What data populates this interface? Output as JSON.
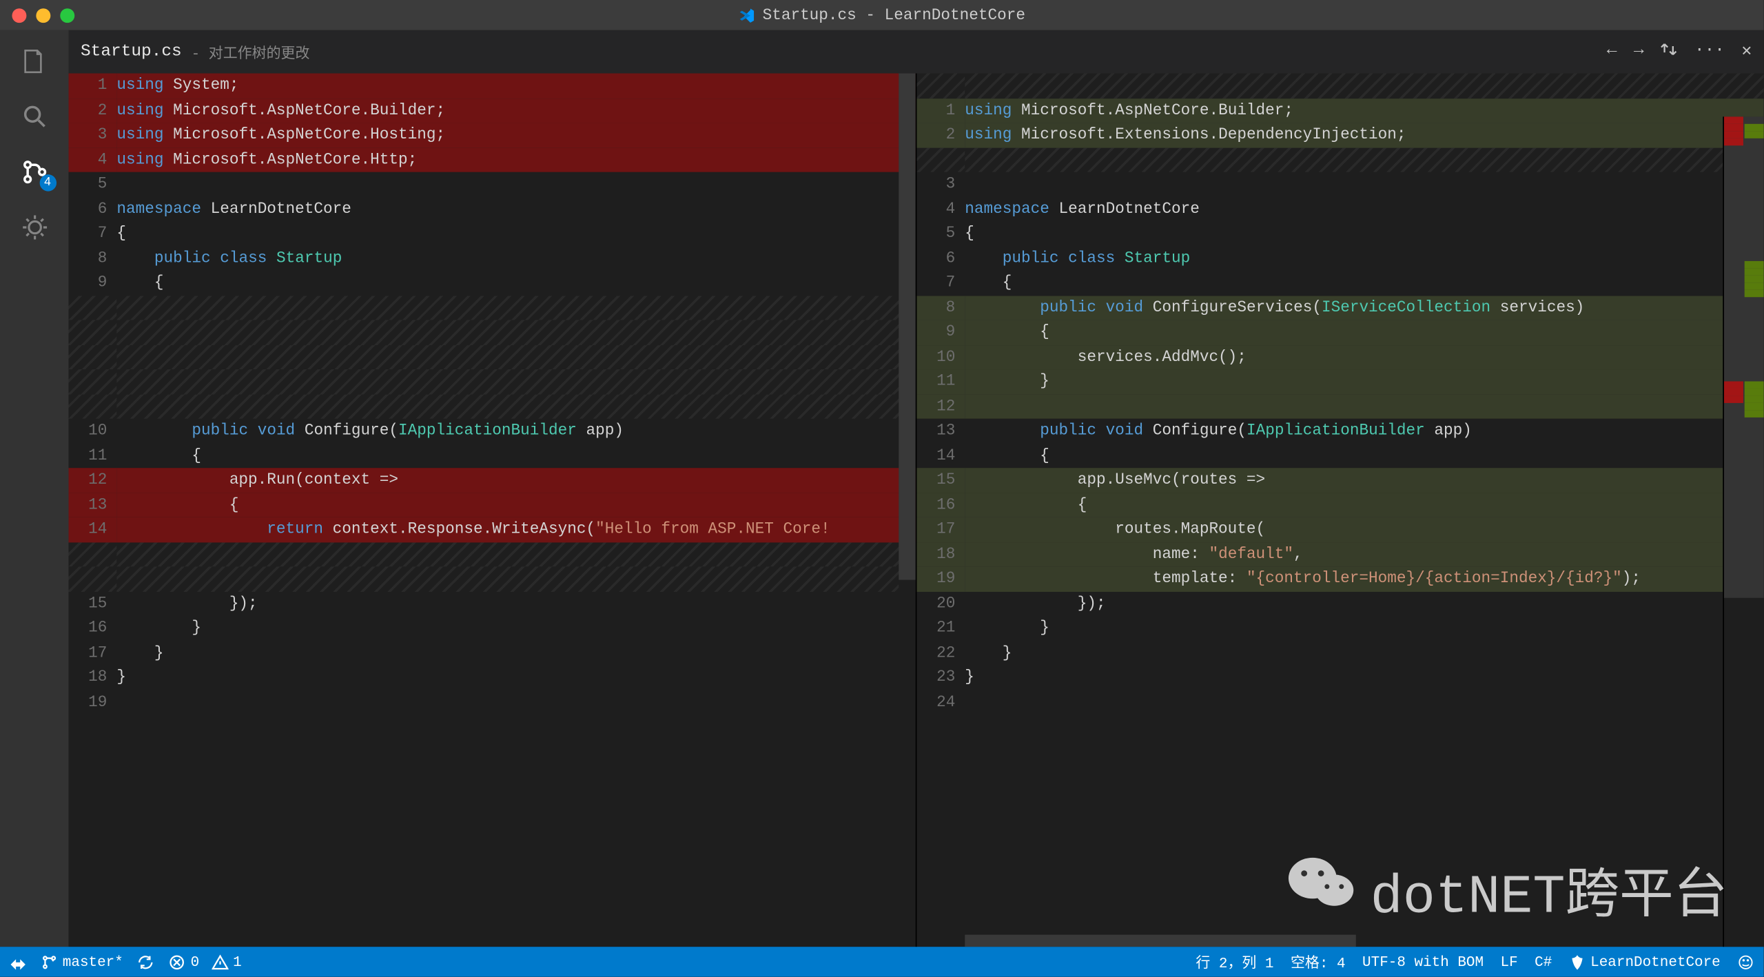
{
  "window": {
    "title": "Startup.cs - LearnDotnetCore"
  },
  "activitybar": {
    "scm_badge": "4"
  },
  "tab": {
    "filename": "Startup.cs",
    "description": "- 对工作树的更改"
  },
  "tabactions": {
    "prev": "←",
    "next": "→",
    "swap": "⇅",
    "more": "···",
    "close": "✕"
  },
  "left": {
    "lines": [
      {
        "n": "1",
        "cls": "del",
        "tokens": [
          [
            "kw",
            "using"
          ],
          [
            "ns",
            " System;"
          ]
        ]
      },
      {
        "n": "2",
        "cls": "del",
        "tokens": [
          [
            "kw",
            "using"
          ],
          [
            "ns",
            " Microsoft.AspNetCore.Builder;"
          ]
        ]
      },
      {
        "n": "3",
        "cls": "del",
        "tokens": [
          [
            "kw",
            "using"
          ],
          [
            "ns",
            " Microsoft.AspNetCore.Hosting;"
          ]
        ]
      },
      {
        "n": "4",
        "cls": "del",
        "tokens": [
          [
            "kw",
            "using"
          ],
          [
            "ns",
            " Microsoft.AspNetCore.Http;"
          ]
        ]
      },
      {
        "n": "5",
        "cls": "",
        "tokens": []
      },
      {
        "n": "6",
        "cls": "",
        "tokens": [
          [
            "kw",
            "namespace"
          ],
          [
            "ns",
            " LearnDotnetCore"
          ]
        ]
      },
      {
        "n": "7",
        "cls": "",
        "tokens": [
          [
            "ns",
            "{"
          ]
        ]
      },
      {
        "n": "8",
        "cls": "",
        "tokens": [
          [
            "ns",
            "    "
          ],
          [
            "kw",
            "public class"
          ],
          [
            "ns",
            " "
          ],
          [
            "tp",
            "Startup"
          ]
        ]
      },
      {
        "n": "9",
        "cls": "",
        "tokens": [
          [
            "ns",
            "    {"
          ]
        ]
      },
      {
        "n": "",
        "cls": "hatch",
        "tokens": []
      },
      {
        "n": "",
        "cls": "hatch",
        "tokens": []
      },
      {
        "n": "",
        "cls": "hatch",
        "tokens": []
      },
      {
        "n": "",
        "cls": "hatch",
        "tokens": []
      },
      {
        "n": "",
        "cls": "hatch",
        "tokens": []
      },
      {
        "n": "10",
        "cls": "",
        "tokens": [
          [
            "ns",
            "        "
          ],
          [
            "kw",
            "public void"
          ],
          [
            "ns",
            " Configure("
          ],
          [
            "tp",
            "IApplicationBuilder"
          ],
          [
            "ns",
            " app)"
          ]
        ]
      },
      {
        "n": "11",
        "cls": "",
        "tokens": [
          [
            "ns",
            "        {"
          ]
        ]
      },
      {
        "n": "12",
        "cls": "del",
        "tokens": [
          [
            "ns",
            "            app.Run(context =>"
          ]
        ]
      },
      {
        "n": "13",
        "cls": "del",
        "tokens": [
          [
            "ns",
            "            {"
          ]
        ]
      },
      {
        "n": "14",
        "cls": "del",
        "tokens": [
          [
            "ns",
            "                "
          ],
          [
            "kw",
            "return"
          ],
          [
            "ns",
            " context.Response.WriteAsync("
          ],
          [
            "st",
            "\"Hello from ASP.NET Core!"
          ]
        ]
      },
      {
        "n": "",
        "cls": "hatch",
        "tokens": []
      },
      {
        "n": "",
        "cls": "hatch",
        "tokens": []
      },
      {
        "n": "15",
        "cls": "",
        "tokens": [
          [
            "ns",
            "            });"
          ]
        ]
      },
      {
        "n": "16",
        "cls": "",
        "tokens": [
          [
            "ns",
            "        }"
          ]
        ]
      },
      {
        "n": "17",
        "cls": "",
        "tokens": [
          [
            "ns",
            "    }"
          ]
        ]
      },
      {
        "n": "18",
        "cls": "",
        "tokens": [
          [
            "ns",
            "}"
          ]
        ]
      },
      {
        "n": "19",
        "cls": "",
        "tokens": []
      }
    ]
  },
  "right": {
    "lines": [
      {
        "n": "",
        "cls": "hatch",
        "tokens": []
      },
      {
        "n": "1",
        "cls": "ins",
        "tokens": [
          [
            "kw",
            "using"
          ],
          [
            "ns",
            " Microsoft.AspNetCore.Builder;"
          ]
        ]
      },
      {
        "n": "2",
        "cls": "ins",
        "tokens": [
          [
            "kw",
            "using"
          ],
          [
            "ns",
            " Microsoft.Extensions.DependencyInjection;"
          ]
        ]
      },
      {
        "n": "",
        "cls": "hatch",
        "tokens": []
      },
      {
        "n": "3",
        "cls": "",
        "tokens": []
      },
      {
        "n": "4",
        "cls": "",
        "tokens": [
          [
            "kw",
            "namespace"
          ],
          [
            "ns",
            " LearnDotnetCore"
          ]
        ]
      },
      {
        "n": "5",
        "cls": "",
        "tokens": [
          [
            "ns",
            "{"
          ]
        ]
      },
      {
        "n": "6",
        "cls": "",
        "tokens": [
          [
            "ns",
            "    "
          ],
          [
            "kw",
            "public class"
          ],
          [
            "ns",
            " "
          ],
          [
            "tp",
            "Startup"
          ]
        ]
      },
      {
        "n": "7",
        "cls": "",
        "tokens": [
          [
            "ns",
            "    {"
          ]
        ]
      },
      {
        "n": "8",
        "cls": "ins",
        "tokens": [
          [
            "ns",
            "        "
          ],
          [
            "kw",
            "public void"
          ],
          [
            "ns",
            " ConfigureServices("
          ],
          [
            "tp",
            "IServiceCollection"
          ],
          [
            "ns",
            " services)"
          ]
        ]
      },
      {
        "n": "9",
        "cls": "ins",
        "tokens": [
          [
            "ns",
            "        {"
          ]
        ]
      },
      {
        "n": "10",
        "cls": "ins",
        "tokens": [
          [
            "ns",
            "            services.AddMvc();"
          ]
        ]
      },
      {
        "n": "11",
        "cls": "ins",
        "tokens": [
          [
            "ns",
            "        }"
          ]
        ]
      },
      {
        "n": "12",
        "cls": "ins",
        "tokens": []
      },
      {
        "n": "13",
        "cls": "",
        "tokens": [
          [
            "ns",
            "        "
          ],
          [
            "kw",
            "public void"
          ],
          [
            "ns",
            " Configure("
          ],
          [
            "tp",
            "IApplicationBuilder"
          ],
          [
            "ns",
            " app)"
          ]
        ]
      },
      {
        "n": "14",
        "cls": "",
        "tokens": [
          [
            "ns",
            "        {"
          ]
        ]
      },
      {
        "n": "15",
        "cls": "ins",
        "tokens": [
          [
            "ns",
            "            app.UseMvc(routes =>"
          ]
        ]
      },
      {
        "n": "16",
        "cls": "ins",
        "tokens": [
          [
            "ns",
            "            {"
          ]
        ]
      },
      {
        "n": "17",
        "cls": "ins",
        "tokens": [
          [
            "ns",
            "                routes.MapRoute("
          ]
        ]
      },
      {
        "n": "18",
        "cls": "ins",
        "tokens": [
          [
            "ns",
            "                    name: "
          ],
          [
            "st",
            "\"default\""
          ],
          [
            "ns",
            ","
          ]
        ]
      },
      {
        "n": "19",
        "cls": "ins",
        "tokens": [
          [
            "ns",
            "                    template: "
          ],
          [
            "st",
            "\"{controller=Home}/{action=Index}/{id?}\""
          ],
          [
            "ns",
            ");"
          ]
        ]
      },
      {
        "n": "20",
        "cls": "",
        "tokens": [
          [
            "ns",
            "            });"
          ]
        ]
      },
      {
        "n": "21",
        "cls": "",
        "tokens": [
          [
            "ns",
            "        }"
          ]
        ]
      },
      {
        "n": "22",
        "cls": "",
        "tokens": [
          [
            "ns",
            "    }"
          ]
        ]
      },
      {
        "n": "23",
        "cls": "",
        "tokens": [
          [
            "ns",
            "}"
          ]
        ]
      },
      {
        "n": "24",
        "cls": "",
        "tokens": []
      }
    ]
  },
  "status": {
    "branch": "master*",
    "errors": "0",
    "warnings": "1",
    "cursor": "行 2，列 1",
    "spaces": "空格: 4",
    "encoding": "UTF-8 with BOM",
    "eol": "LF",
    "lang": "C#",
    "project": "LearnDotnetCore"
  },
  "watermark": "dotNET跨平台"
}
